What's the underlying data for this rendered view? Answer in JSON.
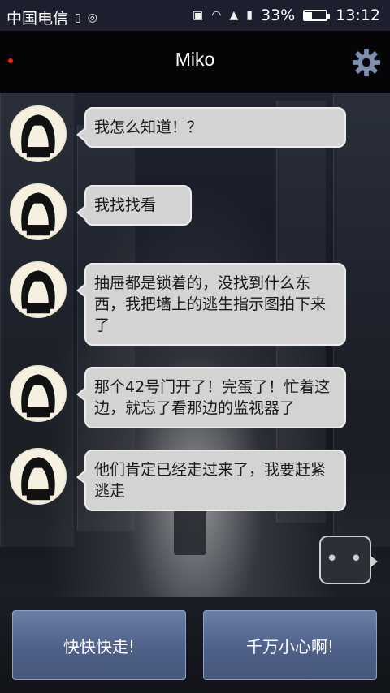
{
  "statusbar": {
    "carrier": "中国电信",
    "battery_text": "33%",
    "battery_level": 0.33,
    "time": "13:12",
    "icons": [
      "sim-icon",
      "usb-icon",
      "nfc-icon",
      "wifi-icon",
      "network-3g-2g-icon",
      "vibrate-icon",
      "battery-icon"
    ]
  },
  "header": {
    "title": "Miko",
    "notification_dot_color": "#ff1b1b",
    "settings_icon": "gear-icon"
  },
  "messages": [
    {
      "sender": "Miko",
      "text": "我怎么知道！？"
    },
    {
      "sender": "Miko",
      "text": "我找找看"
    },
    {
      "sender": "Miko",
      "text": "抽屉都是锁着的，没找到什么东西，我把墙上的逃生指示图拍下来了"
    },
    {
      "sender": "Miko",
      "text": "那个42号门开了！完蛋了！忙着这边，就忘了看那边的监视器了"
    },
    {
      "sender": "Miko",
      "text": "他们肯定已经走过来了，我要赶紧逃走"
    }
  ],
  "typing_indicator": "• • •",
  "choices": [
    {
      "label": "快快快走!"
    },
    {
      "label": "千万小心啊!"
    }
  ]
}
